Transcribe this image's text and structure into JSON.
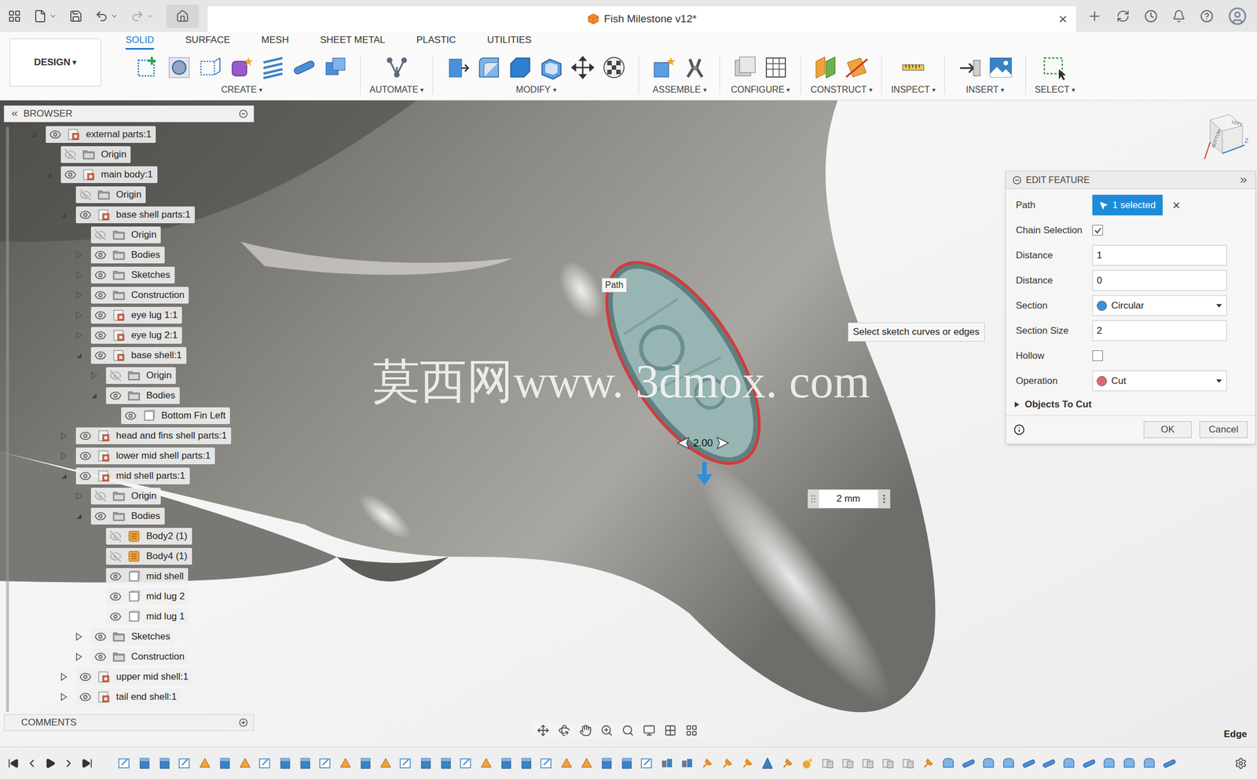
{
  "window": {
    "title": "Fish Milestone v12*",
    "close": "×"
  },
  "workspace": {
    "label": "DESIGN",
    "caret": "▾"
  },
  "ribbon_tabs": [
    {
      "label": "SOLID",
      "selected": true
    },
    {
      "label": "SURFACE",
      "selected": false
    },
    {
      "label": "MESH",
      "selected": false
    },
    {
      "label": "SHEET METAL",
      "selected": false
    },
    {
      "label": "PLASTIC",
      "selected": false
    },
    {
      "label": "UTILITIES",
      "selected": false
    }
  ],
  "tool_groups": [
    {
      "label": "CREATE",
      "caret": "▾",
      "tools": [
        "create-sketch",
        "sketch-circle",
        "sketch-project",
        "create-form",
        "rib",
        "pipe",
        "combine-box"
      ]
    },
    {
      "label": "AUTOMATE",
      "caret": "▾",
      "tools": [
        "automate"
      ]
    },
    {
      "label": "MODIFY",
      "caret": "▾",
      "tools": [
        "press-pull",
        "fillet",
        "chamfer",
        "shell",
        "move",
        "appearance"
      ]
    },
    {
      "label": "ASSEMBLE",
      "caret": "▾",
      "tools": [
        "new-component",
        "joint"
      ]
    },
    {
      "label": "CONFIGURE",
      "caret": "▾",
      "tools": [
        "configure",
        "table"
      ]
    },
    {
      "label": "CONSTRUCT",
      "caret": "▾",
      "tools": [
        "offset-plane",
        "plane-along"
      ]
    },
    {
      "label": "INSPECT",
      "caret": "▾",
      "tools": [
        "measure"
      ]
    },
    {
      "label": "INSERT",
      "caret": "▾",
      "tools": [
        "insert-derive",
        "canvas"
      ]
    },
    {
      "label": "SELECT",
      "caret": "▾",
      "tools": [
        "select"
      ]
    }
  ],
  "browser": {
    "title": "BROWSER",
    "items": [
      {
        "label": "external parts:1",
        "depth": 0,
        "kind": "component",
        "visible": true,
        "has_children": true,
        "expanded": true
      },
      {
        "label": "Origin",
        "depth": 1,
        "kind": "folder",
        "visible": false,
        "has_children": true,
        "expanded": false
      },
      {
        "label": "main body:1",
        "depth": 1,
        "kind": "component",
        "visible": true,
        "has_children": true,
        "expanded": true
      },
      {
        "label": "Origin",
        "depth": 2,
        "kind": "folder",
        "visible": false,
        "has_children": true,
        "expanded": false
      },
      {
        "label": "base shell parts:1",
        "depth": 2,
        "kind": "component",
        "visible": true,
        "has_children": true,
        "expanded": true
      },
      {
        "label": "Origin",
        "depth": 3,
        "kind": "folder",
        "visible": false,
        "has_children": true,
        "expanded": false
      },
      {
        "label": "Bodies",
        "depth": 3,
        "kind": "folder",
        "visible": true,
        "has_children": true,
        "expanded": false
      },
      {
        "label": "Sketches",
        "depth": 3,
        "kind": "folder",
        "visible": true,
        "has_children": true,
        "expanded": false
      },
      {
        "label": "Construction",
        "depth": 3,
        "kind": "folder",
        "visible": true,
        "has_children": true,
        "expanded": false
      },
      {
        "label": "eye lug 1:1",
        "depth": 3,
        "kind": "component",
        "visible": true,
        "has_children": true,
        "expanded": false
      },
      {
        "label": "eye lug 2:1",
        "depth": 3,
        "kind": "component",
        "visible": true,
        "has_children": true,
        "expanded": false
      },
      {
        "label": "base shell:1",
        "depth": 3,
        "kind": "component",
        "visible": true,
        "has_children": true,
        "expanded": true
      },
      {
        "label": "Origin",
        "depth": 4,
        "kind": "folder",
        "visible": false,
        "has_children": true,
        "expanded": false
      },
      {
        "label": "Bodies",
        "depth": 4,
        "kind": "folder",
        "visible": true,
        "has_children": true,
        "expanded": true
      },
      {
        "label": "Bottom Fin Left",
        "depth": 5,
        "kind": "body",
        "visible": true,
        "has_children": false,
        "expanded": false
      },
      {
        "label": "head and fins shell parts:1",
        "depth": 2,
        "kind": "component",
        "visible": true,
        "has_children": true,
        "expanded": false
      },
      {
        "label": "lower mid shell parts:1",
        "depth": 2,
        "kind": "component",
        "visible": true,
        "has_children": true,
        "expanded": false
      },
      {
        "label": "mid shell parts:1",
        "depth": 2,
        "kind": "component",
        "visible": true,
        "has_children": true,
        "expanded": true
      },
      {
        "label": "Origin",
        "depth": 3,
        "kind": "folder",
        "visible": false,
        "has_children": true,
        "expanded": false
      },
      {
        "label": "Bodies",
        "depth": 3,
        "kind": "folder",
        "visible": true,
        "has_children": true,
        "expanded": true
      },
      {
        "label": "Body2 (1)",
        "depth": 4,
        "kind": "body-orange",
        "visible": false,
        "has_children": false,
        "expanded": false
      },
      {
        "label": "Body4 (1)",
        "depth": 4,
        "kind": "body-orange",
        "visible": false,
        "has_children": false,
        "expanded": false
      },
      {
        "label": "mid shell",
        "depth": 4,
        "kind": "body",
        "visible": true,
        "has_children": false,
        "expanded": false
      },
      {
        "label": "mid lug 2",
        "depth": 4,
        "kind": "body",
        "visible": true,
        "has_children": false,
        "expanded": false
      },
      {
        "label": "mid lug 1",
        "depth": 4,
        "kind": "body",
        "visible": true,
        "has_children": false,
        "expanded": false
      },
      {
        "label": "Sketches",
        "depth": 3,
        "kind": "folder",
        "visible": true,
        "has_children": true,
        "expanded": false
      },
      {
        "label": "Construction",
        "depth": 3,
        "kind": "folder",
        "visible": true,
        "has_children": true,
        "expanded": false
      },
      {
        "label": "upper mid shell:1",
        "depth": 2,
        "kind": "component",
        "visible": true,
        "has_children": true,
        "expanded": false
      },
      {
        "label": "tail end shell:1",
        "depth": 2,
        "kind": "component",
        "visible": true,
        "has_children": true,
        "expanded": false
      }
    ]
  },
  "comments": {
    "title": "COMMENTS"
  },
  "edit_feature": {
    "title": "EDIT FEATURE",
    "rows": [
      {
        "label": "Path",
        "kind": "selection",
        "value": "1 selected",
        "clear": "×"
      },
      {
        "label": "Chain Selection",
        "kind": "checkbox",
        "checked": true
      },
      {
        "label": "Distance",
        "kind": "number",
        "value": "1"
      },
      {
        "label": "Distance",
        "kind": "number",
        "value": "0"
      },
      {
        "label": "Section",
        "kind": "dropdown",
        "value": "Circular",
        "color": "#3b8fe0"
      },
      {
        "label": "Section Size",
        "kind": "number",
        "value": "2"
      },
      {
        "label": "Hollow",
        "kind": "checkbox",
        "checked": false
      },
      {
        "label": "Operation",
        "kind": "dropdown",
        "value": "Cut",
        "color": "#e06a6a"
      }
    ],
    "expander": {
      "label": "Objects To Cut",
      "expanded": false
    },
    "buttons": [
      "OK",
      "Cancel"
    ]
  },
  "canvas": {
    "watermark": "莫西网www. 3dmox. com",
    "path_label": "Path",
    "dimension": "2.00",
    "input_value": "2 mm",
    "tooltip": "Select sketch curves or edges"
  },
  "viewcube": {
    "faces": [
      "LEFT",
      "BOTTOM"
    ],
    "axis": "Z"
  },
  "status": {
    "selection": "Edge"
  },
  "timeline": {
    "features": [
      "sketch",
      "extrude",
      "extrude",
      "sketch",
      "body-orange",
      "extrude",
      "body-orange",
      "sketch",
      "extrude",
      "extrude",
      "sketch",
      "body-orange",
      "extrude",
      "body-orange",
      "sketch",
      "extrude",
      "extrude",
      "sketch",
      "body-orange",
      "extrude",
      "extrude",
      "sketch",
      "body-orange",
      "body-orange",
      "extrude",
      "extrude",
      "sketch",
      "joint",
      "joint",
      "pin",
      "pin",
      "pin",
      "plane",
      "pin",
      "star",
      "component",
      "component",
      "component",
      "component",
      "component",
      "pin",
      "shell",
      "tube",
      "shell",
      "shell",
      "tube",
      "tube",
      "shell",
      "tube",
      "shell",
      "shell",
      "shell",
      "tube"
    ]
  }
}
